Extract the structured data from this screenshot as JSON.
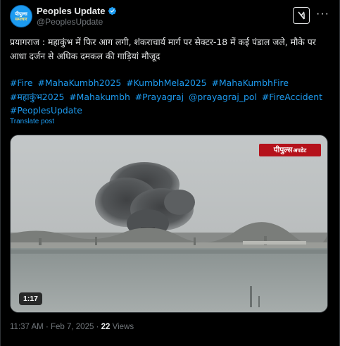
{
  "account": {
    "display_name": "Peoples Update",
    "handle": "@PeoplesUpdate",
    "avatar_line1": "पीपुल्स",
    "avatar_line2": "समाचार"
  },
  "post": {
    "text": "प्रयागराज : महाकुंभ में फिर आग लगी, शंकराचार्य मार्ग पर सेक्टर-18 में कई पंडाल जले, मौके पर आधा दर्जन से अधिक दमकल की गाड़ियां मौजूद",
    "hashtags": [
      "#Fire",
      "#MahaKumbh2025",
      "#KumbhMela2025",
      "#MahaKumbhFire",
      "#महाकुंभ2025",
      "#Mahakumbh",
      "#Prayagraj",
      "@prayagraj_pol",
      "#FireAccident",
      "#PeoplesUpdate"
    ],
    "translate_label": "Translate post"
  },
  "video": {
    "badge_main": "पीपुल्स",
    "badge_small": "अपडेट",
    "duration": "1:17"
  },
  "meta": {
    "time": "11:37 AM",
    "date": "Feb 7, 2025",
    "views_count": "22",
    "views_label": "Views"
  },
  "colors": {
    "background": "#000000",
    "text": "#e7e9ea",
    "muted": "#71767b",
    "link": "#1d9bf0",
    "badge": "#b5121b"
  },
  "icons": {
    "verified": "verified-badge-icon",
    "grok": "grok-icon",
    "more": "more-options-icon"
  }
}
